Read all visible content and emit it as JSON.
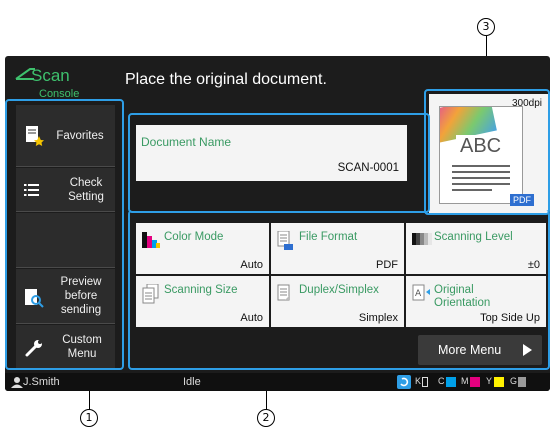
{
  "app": {
    "brand": "Scan",
    "brand_sub": "Console"
  },
  "header": {
    "message": "Place the original document."
  },
  "sidebar": {
    "items": [
      {
        "label": "Favorites",
        "icon": "favorites-icon"
      },
      {
        "label": "Check Setting",
        "icon": "list-icon"
      },
      {
        "label": "Preview before sending",
        "icon": "preview-icon"
      },
      {
        "label": "Custom Menu",
        "icon": "wrench-icon"
      }
    ]
  },
  "document": {
    "label": "Document Name",
    "value": "SCAN-0001"
  },
  "preview": {
    "resolution": "300dpi",
    "text": "ABC",
    "format": "PDF"
  },
  "settings": [
    {
      "label": "Color Mode",
      "value": "Auto",
      "icon": "color-mode-icon"
    },
    {
      "label": "File Format",
      "value": "PDF",
      "icon": "file-format-icon"
    },
    {
      "label": "Scanning Level",
      "value": "±0",
      "icon": "scanning-level-icon"
    },
    {
      "label": "Scanning Size",
      "value": "Auto",
      "icon": "scanning-size-icon"
    },
    {
      "label": "Duplex/Simplex",
      "value": "Simplex",
      "icon": "duplex-icon"
    },
    {
      "label": "Original Orientation",
      "value": "Top Side Up",
      "icon": "orientation-icon"
    }
  ],
  "more_menu": {
    "label": "More Menu"
  },
  "status_bar": {
    "user": "J.Smith",
    "status": "Idle",
    "inks": [
      {
        "label": "K",
        "color": "#ffffff"
      },
      {
        "label": "C",
        "color": "#00a0e9"
      },
      {
        "label": "M",
        "color": "#e4007f"
      },
      {
        "label": "Y",
        "color": "#fff100"
      },
      {
        "label": "G",
        "color": "#9a9a9a"
      }
    ]
  },
  "callouts": {
    "c1": "1",
    "c2": "2",
    "c3": "3"
  },
  "colors": {
    "accent": "#3ec06d",
    "highlight": "#2e9ee6",
    "screen_bg": "#1c1c1c"
  }
}
